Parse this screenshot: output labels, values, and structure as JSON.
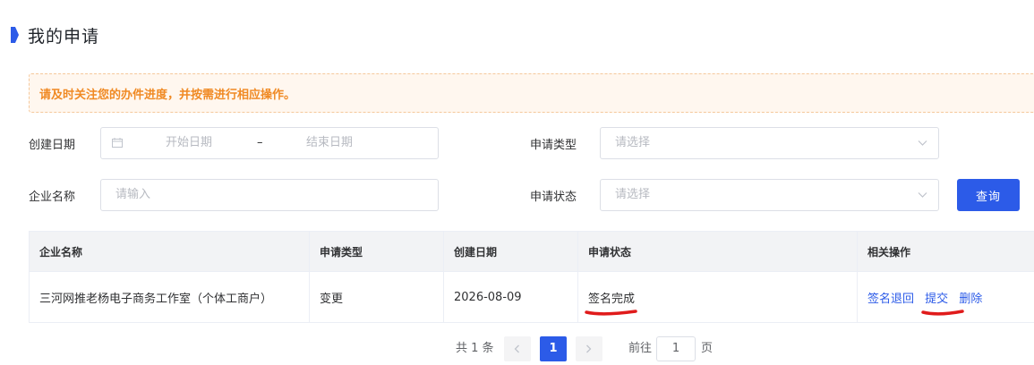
{
  "page": {
    "title": "我的申请"
  },
  "notice": {
    "text": "请及时关注您的办件进度，并按需进行相应操作。"
  },
  "filters": {
    "created_date": {
      "label": "创建日期",
      "start_placeholder": "开始日期",
      "separator": "–",
      "end_placeholder": "结束日期"
    },
    "apply_type": {
      "label": "申请类型",
      "placeholder": "请选择"
    },
    "company_name": {
      "label": "企业名称",
      "placeholder": "请输入"
    },
    "apply_status": {
      "label": "申请状态",
      "placeholder": "请选择"
    },
    "query_button": "查询"
  },
  "table": {
    "headers": [
      "企业名称",
      "申请类型",
      "创建日期",
      "申请状态",
      "相关操作"
    ],
    "rows": [
      {
        "company": "三河网推老杨电子商务工作室（个体工商户）",
        "type": "变更",
        "created": "2026-08-09",
        "status": "签名完成",
        "actions": [
          "签名退回",
          "提交",
          "删除"
        ]
      }
    ]
  },
  "pagination": {
    "total_text": "共 1 条",
    "current_page": "1",
    "goto_label": "前往",
    "goto_value": "1",
    "page_suffix": "页"
  },
  "colors": {
    "primary": "#2c5be8",
    "notice_text": "#f08a24",
    "annotation": "#e01b1b"
  }
}
